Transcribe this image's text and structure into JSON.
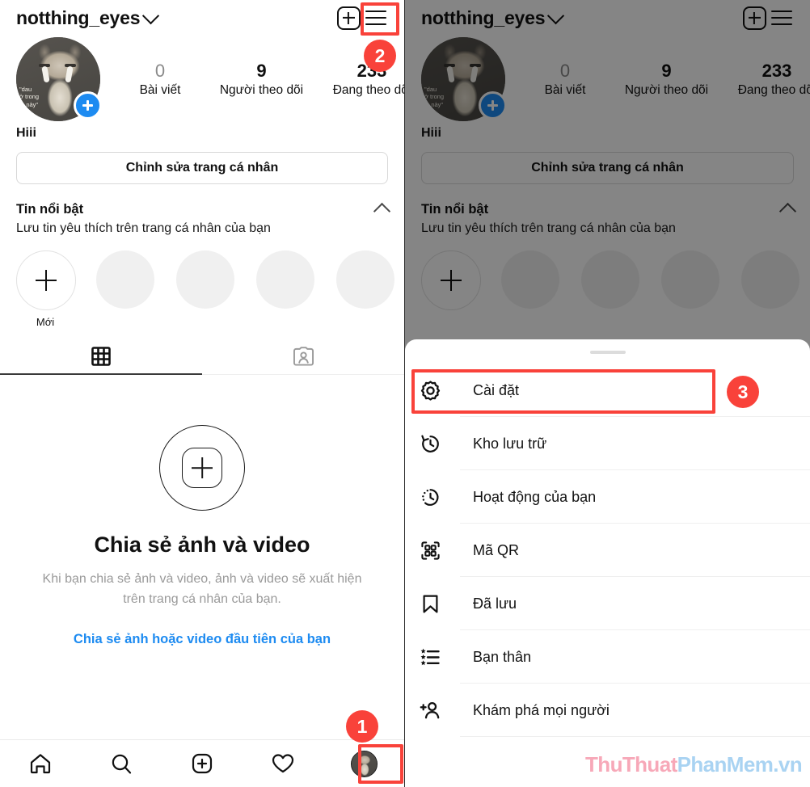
{
  "profile": {
    "username": "notthing_eyes",
    "dropdown_icon": "chevron-down-icon",
    "add_icon": "plus-square-icon",
    "menu_icon": "hamburger-icon",
    "avatar_caption_line1": "\"dau",
    "avatar_caption_line2": "ở trong",
    "avatar_caption_line3": "m này\"",
    "bio": "Hiii",
    "edit_button": "Chỉnh sửa trang cá nhân",
    "stats": [
      {
        "value": "0",
        "label": "Bài viết"
      },
      {
        "value": "9",
        "label": "Người theo dõi"
      },
      {
        "value": "233",
        "label": "Đang theo dõi"
      }
    ],
    "highlights": {
      "title": "Tin nổi bật",
      "subtitle": "Lưu tin yêu thích trên trang cá nhân của bạn",
      "new_label": "Mới",
      "collapse_icon": "chevron-up-icon",
      "placeholder_count": 4
    },
    "tabs": [
      {
        "name": "grid-tab",
        "icon": "grid-icon",
        "active": true
      },
      {
        "name": "tagged-tab",
        "icon": "tagged-person-icon",
        "active": false
      }
    ],
    "empty_state": {
      "icon": "plus-circle-icon",
      "title": "Chia sẻ ảnh và video",
      "body": "Khi bạn chia sẻ ảnh và video, ảnh và video sẽ xuất hiện trên trang cá nhân của bạn.",
      "link": "Chia sẻ ảnh hoặc video đầu tiên của bạn"
    },
    "bottom_nav": [
      {
        "name": "home-nav",
        "icon": "home-icon"
      },
      {
        "name": "search-nav",
        "icon": "search-icon"
      },
      {
        "name": "create-nav",
        "icon": "plus-square-icon"
      },
      {
        "name": "activity-nav",
        "icon": "heart-icon"
      },
      {
        "name": "profile-nav",
        "icon": "avatar-icon"
      }
    ]
  },
  "sheet": {
    "items": [
      {
        "label": "Cài đặt",
        "icon": "settings-gear-icon"
      },
      {
        "label": "Kho lưu trữ",
        "icon": "archive-clock-icon"
      },
      {
        "label": "Hoạt động của bạn",
        "icon": "activity-clock-icon"
      },
      {
        "label": "Mã QR",
        "icon": "qr-code-icon"
      },
      {
        "label": "Đã lưu",
        "icon": "bookmark-icon"
      },
      {
        "label": "Bạn thân",
        "icon": "close-friends-list-icon"
      },
      {
        "label": "Khám phá mọi người",
        "icon": "discover-people-icon"
      }
    ]
  },
  "annotations": {
    "badges": [
      {
        "number": "1",
        "target": "profile-nav"
      },
      {
        "number": "2",
        "target": "hamburger-menu-button"
      },
      {
        "number": "3",
        "target": "settings-menu-item"
      }
    ],
    "highlight_color": "#f9423a"
  },
  "watermark": {
    "part1": "ThuThuat",
    "part2": "PhanMem.vn",
    "color1": "#f7a8b8",
    "color2": "#a9d3f2"
  }
}
